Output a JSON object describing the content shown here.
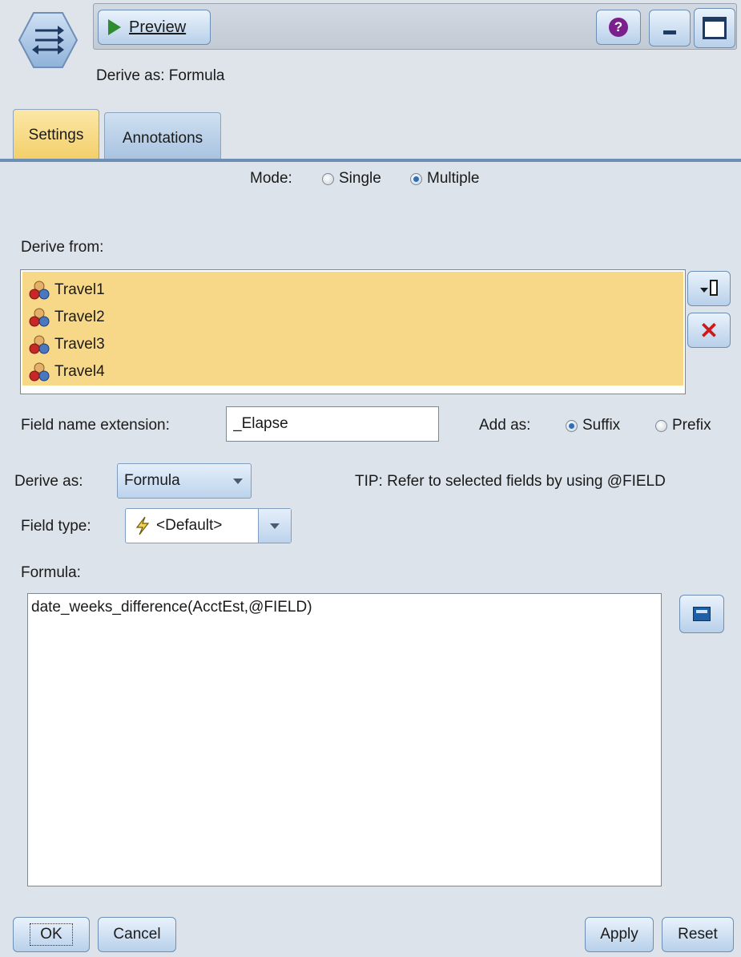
{
  "toolbar": {
    "preview_label": "Preview"
  },
  "header": {
    "subtitle": "Derive as: Formula"
  },
  "tabs": [
    {
      "label": "Settings",
      "active": true
    },
    {
      "label": "Annotations",
      "active": false
    }
  ],
  "mode": {
    "label": "Mode:",
    "options": [
      {
        "label": "Single",
        "selected": false
      },
      {
        "label": "Multiple",
        "selected": true
      }
    ]
  },
  "derive_from": {
    "label": "Derive from:",
    "fields": [
      "Travel1",
      "Travel2",
      "Travel3",
      "Travel4"
    ]
  },
  "field_name_extension": {
    "label": "Field name extension:",
    "value": "_Elapse"
  },
  "add_as": {
    "label": "Add as:",
    "options": [
      {
        "label": "Suffix",
        "selected": true
      },
      {
        "label": "Prefix",
        "selected": false
      }
    ]
  },
  "derive_as": {
    "label": "Derive as:",
    "value": "Formula",
    "tip": "TIP: Refer to selected fields by using @FIELD"
  },
  "field_type": {
    "label": "Field type:",
    "value": "<Default>"
  },
  "formula": {
    "label": "Formula:",
    "value": "date_weeks_difference(AcctEst,@FIELD)"
  },
  "buttons": {
    "ok": "OK",
    "cancel": "Cancel",
    "apply": "Apply",
    "reset": "Reset"
  },
  "colors": {
    "selection_fill": "#f7d889",
    "tab_active": "#f3cf68",
    "tab_inactive": "#a9c3e0",
    "panel_bg": "#dde3ea"
  }
}
